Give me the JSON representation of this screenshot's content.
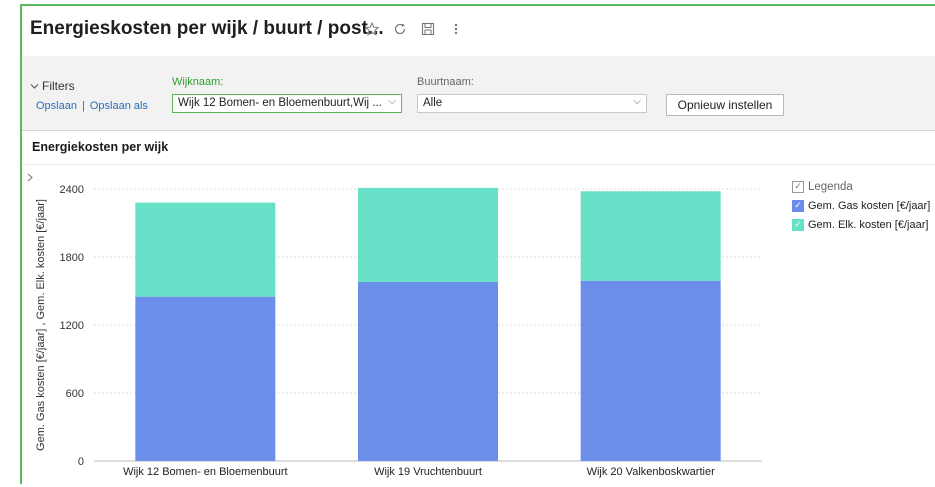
{
  "window": {
    "title": "Energieskosten per wijk / buurt / post...",
    "icons": [
      "star-icon",
      "refresh-icon",
      "save-icon",
      "more-icon"
    ]
  },
  "filters": {
    "toggle_label": "Filters",
    "save_link": "Opslaan",
    "separator": "|",
    "save_as_link": "Opslaan als",
    "wijknaam": {
      "label": "Wijknaam:",
      "value": "Wijk 12 Bomen- en Bloemenbuurt,Wij ..."
    },
    "buurtnaam": {
      "label": "Buurtnaam:",
      "value": "Alle"
    },
    "reset_button": "Opnieuw instellen"
  },
  "panel": {
    "title": "Energiekosten per wijk"
  },
  "legend": {
    "title": "Legenda",
    "items": [
      {
        "label": "Gem. Gas kosten [€/jaar]",
        "color": "#6b8eeb"
      },
      {
        "label": "Gem. Elk. kosten [€/jaar]",
        "color": "#66e0c6"
      }
    ]
  },
  "chart_data": {
    "type": "bar",
    "stacked": true,
    "categories": [
      "Wijk 12 Bomen- en Bloemenbuurt",
      "Wijk 19 Vruchtenbuurt",
      "Wijk 20 Valkenboskwartier"
    ],
    "series": [
      {
        "name": "Gem. Gas kosten [€/jaar]",
        "values": [
          1450,
          1580,
          1590
        ],
        "color": "#6b8eeb"
      },
      {
        "name": "Gem. Elk. kosten [€/jaar]",
        "values": [
          830,
          830,
          790
        ],
        "color": "#66e0c6"
      }
    ],
    "yticks": [
      0,
      600,
      1200,
      1800,
      2400
    ],
    "ylim": [
      0,
      2400
    ],
    "ylabel": "Gem. Gas kosten [€/jaar] , Gem. Elk. kosten [€/jaar]",
    "grid": true,
    "legend_position": "right"
  }
}
